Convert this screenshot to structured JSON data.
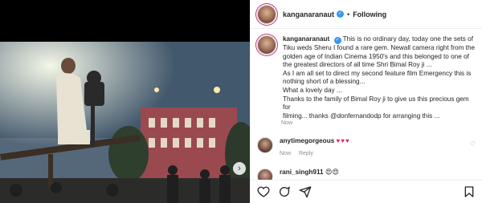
{
  "post": {
    "username": "kanganaranaut",
    "follow_label": "Following",
    "separator": "•",
    "caption_lines": [
      "This is no ordinary day, today one the sets of",
      "Tiku weds Sheru I found a rare gem. Newall camera right from the",
      "golden age of Indian Cinema 1950's and this belonged to one of",
      "the greatest directors of all time Shri Bimal Roy ji ...",
      "As I am all set to direct my second feature film Emergency this is",
      "nothing short of a blessing...",
      "What a lovely day ...",
      "Thanks to the family of Bimal Roy ji to give us this precious gem for",
      "filming... thanks @donfernandodp for arranging this ..."
    ],
    "caption_mention": "@donfernandodp",
    "timestamp": "Now"
  },
  "comments": [
    {
      "username": "anytimegorgeous",
      "text": "♥♥♥",
      "time": "Now",
      "reply": "Reply"
    },
    {
      "username": "rani_singh911",
      "text": "😍😍",
      "time": "",
      "reply": ""
    }
  ],
  "media": {
    "next_glyph": "›"
  },
  "colors": {
    "verified": "#3897f0",
    "heart": "#e0245e",
    "muted": "#8e8e8e",
    "text": "#262626"
  },
  "icons": [
    "verified-badge-icon",
    "heart-icon",
    "comment-icon",
    "share-icon",
    "bookmark-icon",
    "chevron-right-icon"
  ]
}
